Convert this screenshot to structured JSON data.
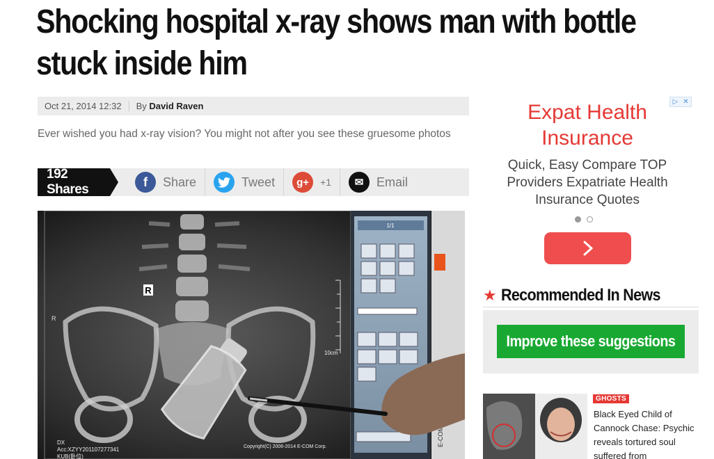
{
  "article": {
    "headline": "Shocking hospital x-ray shows man with bottle stuck inside him",
    "date": "Oct 21, 2014 12:32",
    "by_label": "By",
    "author": "David Raven",
    "standfirst": "Ever wished you had x-ray vision? You might not after you see these gruesome photos"
  },
  "share_bar": {
    "count_label": "192 Shares",
    "items": [
      {
        "label": "Share",
        "icon": "facebook-icon",
        "color": "#3b5998",
        "glyph": "f"
      },
      {
        "label": "Tweet",
        "icon": "twitter-icon",
        "color": "#2aa3ef",
        "glyph": "t"
      },
      {
        "label": "+1",
        "icon": "google-plus-icon",
        "color": "#dd4b39",
        "glyph": "g+"
      },
      {
        "label": "Email",
        "icon": "email-icon",
        "color": "#111111",
        "glyph": "✉"
      }
    ]
  },
  "xray_image": {
    "marker_r": "R",
    "side_r": "R",
    "scale_label": "10cm",
    "corner_lines": [
      "DX",
      "Acc:XZYY2011072773​41",
      "KUB(卧位)"
    ],
    "copyright": "Copyright(C) 2006-2014 E-COM Corp.",
    "toolbar_page": "1/1",
    "side_brand": "E-COM"
  },
  "ad": {
    "badge_left": "▷",
    "badge_right": "✕",
    "title": "Expat Health Insurance",
    "description": "Quick, Easy Compare TOP Providers Expatriate Health Insurance Quotes",
    "accent": "#e53935",
    "button_color": "#f04e4e"
  },
  "recommended": {
    "heading": "Recommended In News",
    "improve_label": "Improve these suggestions",
    "items": [
      {
        "tag": "GHOSTS",
        "text": "Black Eyed Child of Cannock Chase: Psychic reveals tortured soul suffered from"
      }
    ]
  }
}
